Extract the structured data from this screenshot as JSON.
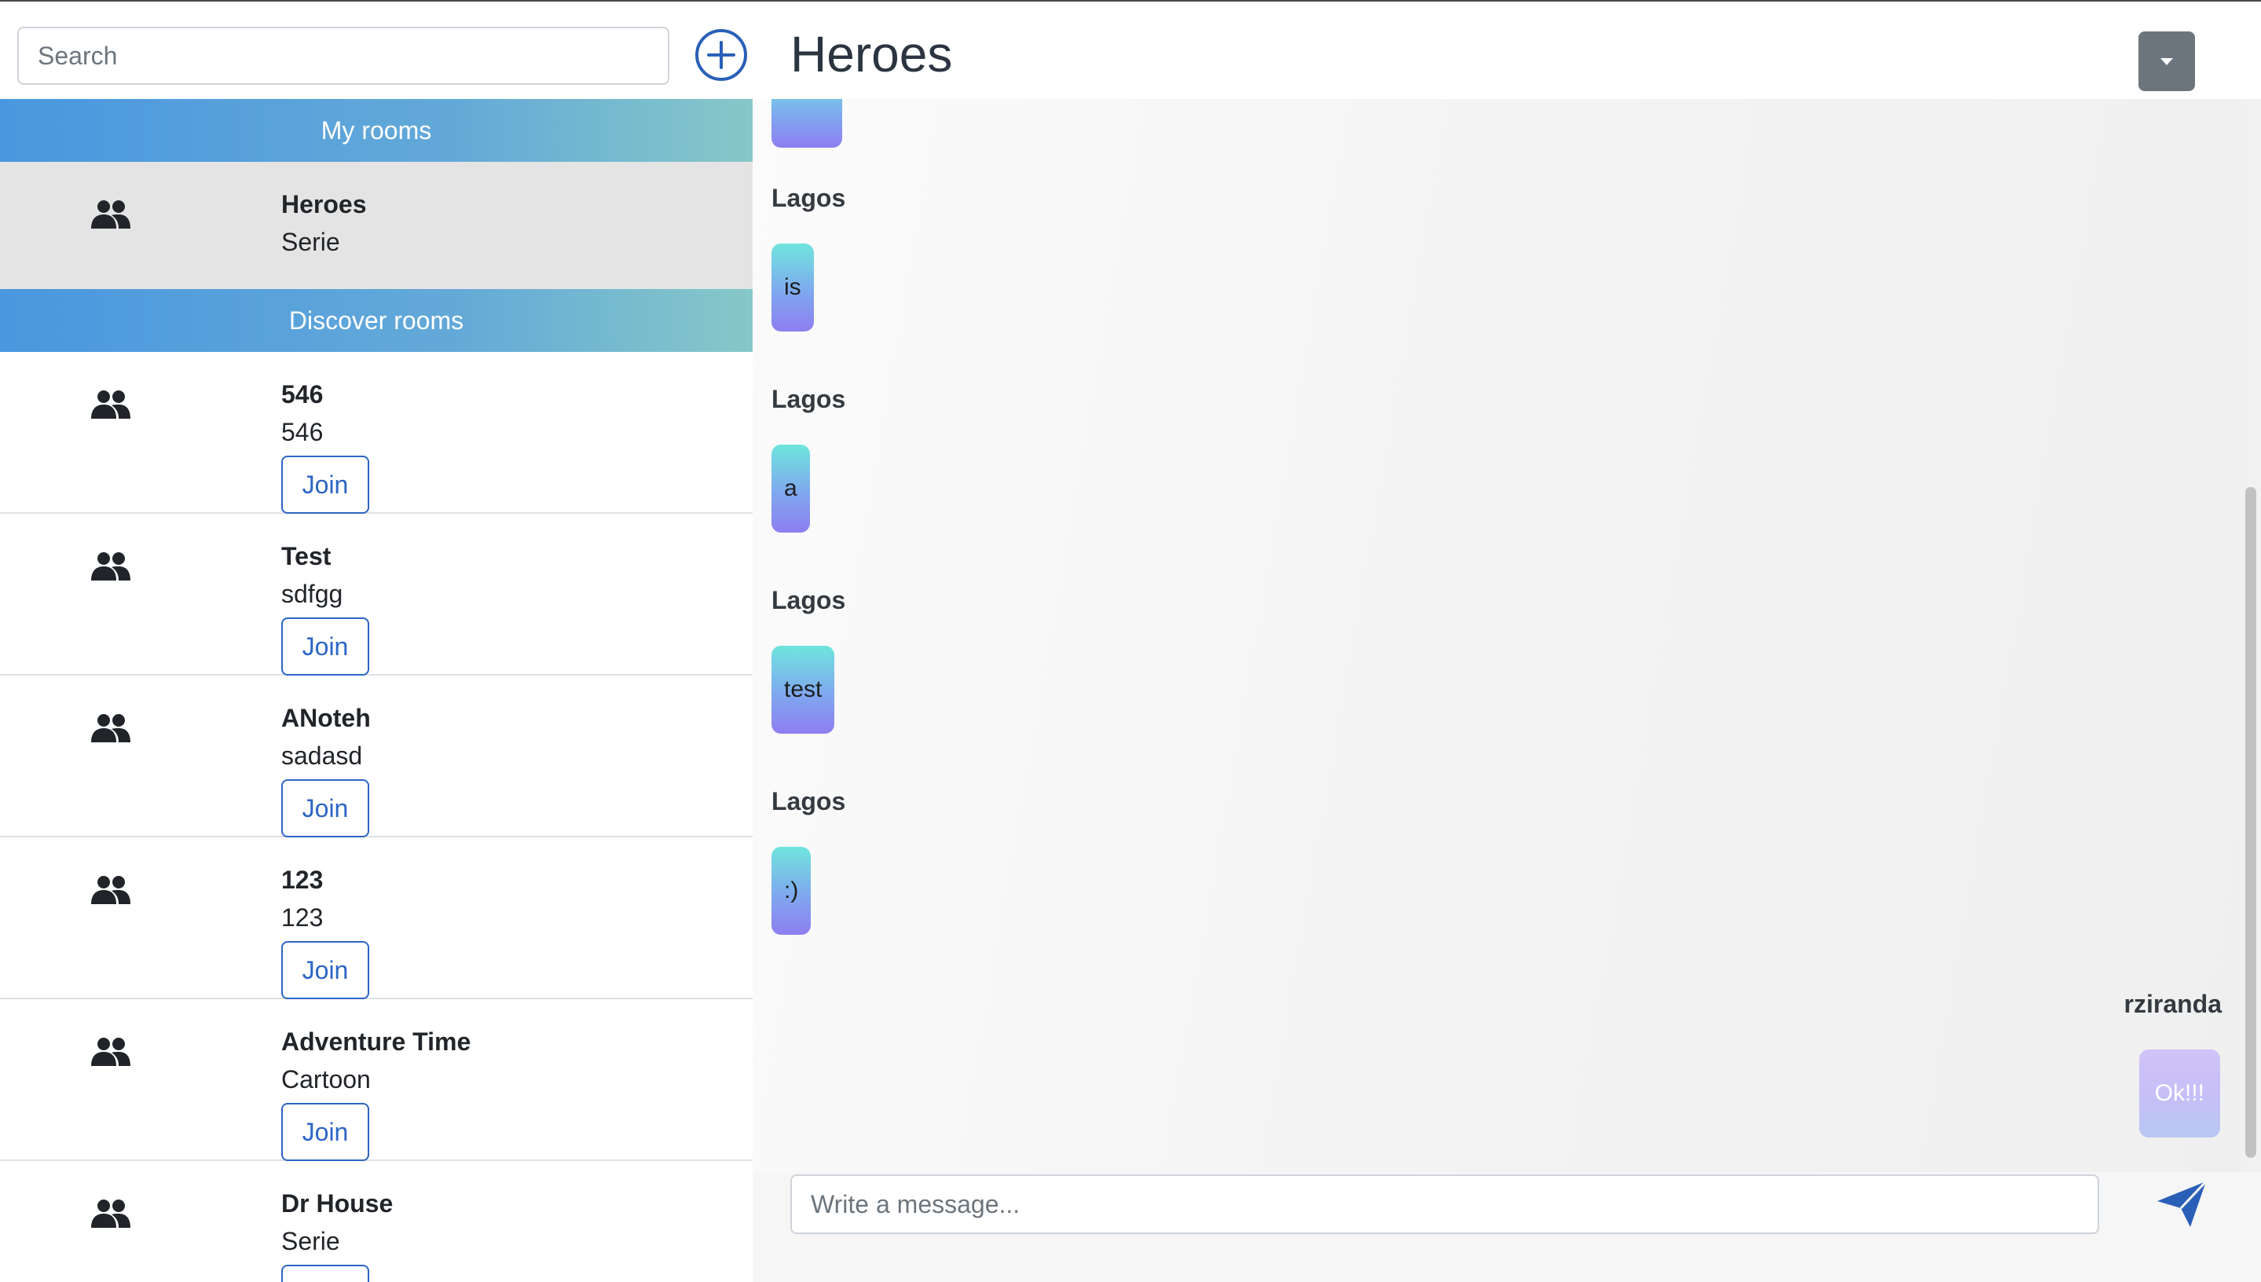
{
  "search": {
    "placeholder": "Search"
  },
  "sidebar": {
    "add_icon": "plus-circle-icon",
    "my_rooms_label": "My rooms",
    "discover_rooms_label": "Discover rooms",
    "my_rooms": [
      {
        "name": "Heroes",
        "description": "Serie",
        "icon": "users-icon"
      }
    ],
    "discover_rooms": [
      {
        "name": "546",
        "description": "546",
        "join_label": "Join",
        "icon": "users-icon"
      },
      {
        "name": "Test",
        "description": "sdfgg",
        "join_label": "Join",
        "icon": "users-icon"
      },
      {
        "name": "ANoteh",
        "description": "sadasd",
        "join_label": "Join",
        "icon": "users-icon"
      },
      {
        "name": "123",
        "description": "123",
        "join_label": "Join",
        "icon": "users-icon"
      },
      {
        "name": "Adventure Time",
        "description": "Cartoon",
        "join_label": "Join",
        "icon": "users-icon"
      },
      {
        "name": "Dr House",
        "description": "Serie",
        "join_label": "Join",
        "icon": "users-icon"
      }
    ]
  },
  "chat": {
    "title": "Heroes",
    "dropdown_icon": "caret-down-icon",
    "messages": [
      {
        "sender": "Lagos",
        "text": "is",
        "own": false
      },
      {
        "sender": "Lagos",
        "text": "a",
        "own": false
      },
      {
        "sender": "Lagos",
        "text": "test",
        "own": false
      },
      {
        "sender": "Lagos",
        "text": ":)",
        "own": false
      },
      {
        "sender": "rziranda",
        "text": "Ok!!!",
        "own": true
      }
    ]
  },
  "composer": {
    "placeholder": "Write a message...",
    "send_icon": "send-icon"
  },
  "colors": {
    "accent_blue": "#2c65c4",
    "header_gradient_start": "#4a97df",
    "header_gradient_end": "#86c8c8",
    "bubble_gradient_top": "#6fe5dd",
    "bubble_gradient_bottom": "#8e7ef0",
    "own_bubble": "#c7bff7",
    "active_room_bg": "#e4e4e4"
  }
}
